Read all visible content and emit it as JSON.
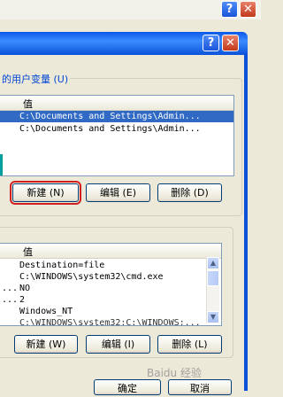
{
  "window": {
    "help_glyph": "?",
    "close_glyph": "✕"
  },
  "user_vars": {
    "group_label": "的用户变量 (U)",
    "value_header": "值",
    "rows": [
      {
        "name": "",
        "value": "C:\\Documents and Settings\\Admin..."
      },
      {
        "name": "",
        "value": "C:\\Documents and Settings\\Admin..."
      }
    ],
    "buttons": {
      "new": "新建 (N)",
      "edit": "编辑 (E)",
      "delete": "删除 (D)"
    }
  },
  "system_vars": {
    "value_header": "值",
    "rows": [
      {
        "name": "",
        "value": "Destination=file"
      },
      {
        "name": "",
        "value": "C:\\WINDOWS\\system32\\cmd.exe"
      },
      {
        "name": "...",
        "value": "NO"
      },
      {
        "name": "...",
        "value": "2"
      },
      {
        "name": "",
        "value": "Windows_NT"
      },
      {
        "name": "",
        "value": "C:\\WINDOWS\\system32;C:\\WINDOWS;..."
      }
    ],
    "buttons": {
      "new": "新建 (W)",
      "edit": "编辑 (I)",
      "delete": "删除 (L)"
    }
  },
  "footer": {
    "ok": "确定",
    "cancel": "取消"
  },
  "watermark": "Baidu 经验",
  "colors": {
    "highlight_border": "#d02020",
    "selection": "#316ac5",
    "titlebar": "#0a58ea"
  }
}
